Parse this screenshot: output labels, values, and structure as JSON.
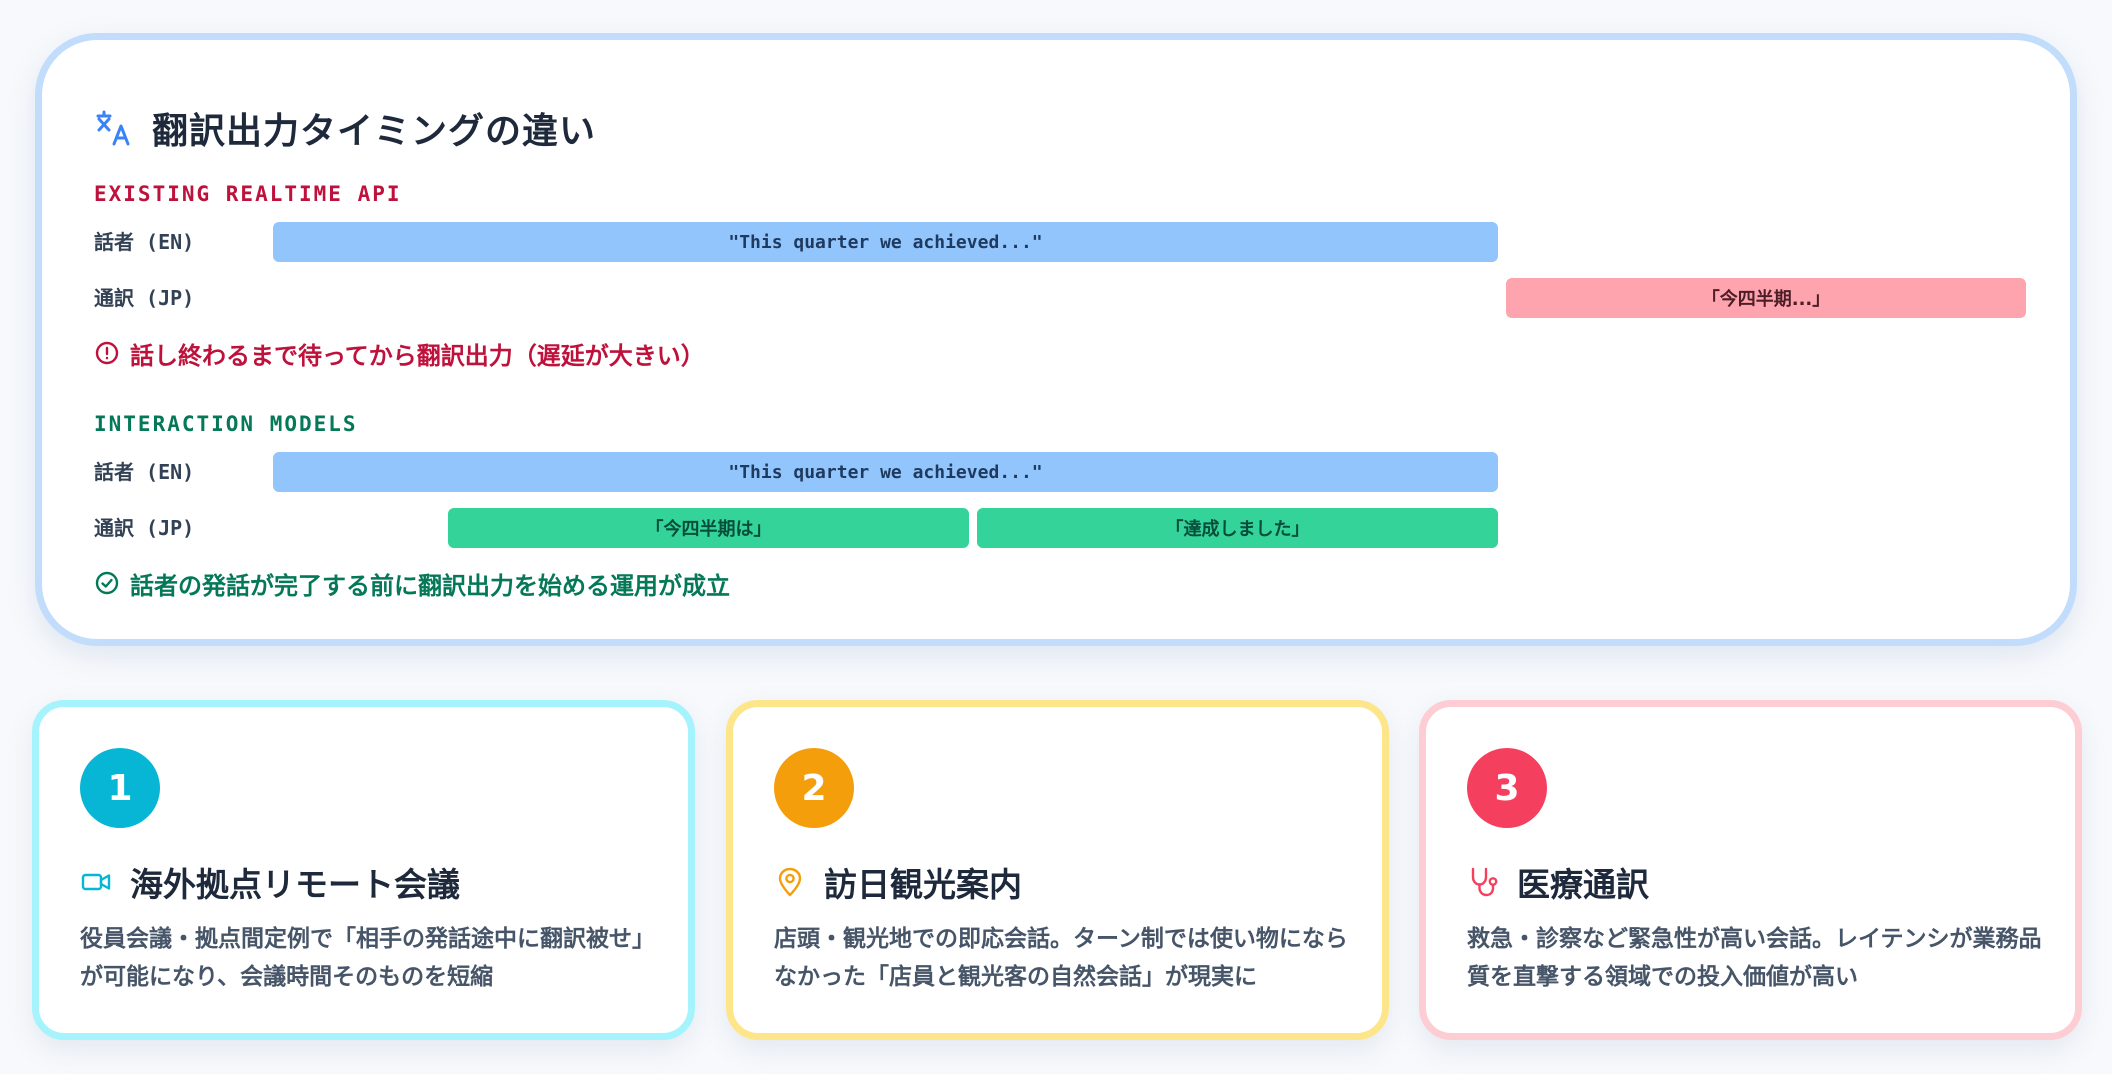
{
  "timing": {
    "title": "翻訳出力タイミングの違い",
    "title_icon": "translate-icon",
    "existing": {
      "label": "EXISTING REALTIME API",
      "speaker_label": "話者 (EN)",
      "speaker_bar": "\"This quarter we achieved...\"",
      "interp_label": "通訳 (JP)",
      "interp_bar": "「今四半期...」",
      "note_icon": "alert-circle-icon",
      "note": "話し終わるまで待ってから翻訳出力（遅延が大きい）"
    },
    "interaction": {
      "label": "INTERACTION MODELS",
      "speaker_label": "話者 (EN)",
      "speaker_bar": "\"This quarter we achieved...\"",
      "interp_label": "通訳 (JP)",
      "interp_bars": [
        "「今四半期は」",
        "「達成しました」"
      ],
      "note_icon": "check-circle-icon",
      "note": "話者の発話が完了する前に翻訳出力を始める運用が成立"
    },
    "colors": {
      "speaker": "#93c5fd",
      "interp_late": "#fda4af",
      "interp_live": "#34d399",
      "warn": "#be123c",
      "ok": "#047857"
    }
  },
  "use_cases": [
    {
      "number": "1",
      "icon": "video-camera-icon",
      "title": "海外拠点リモート会議",
      "description": "役員会議・拠点間定例で「相手の発話途中に翻訳被せ」が可能になり、会議時間そのものを短縮",
      "accent": "#06b6d4"
    },
    {
      "number": "2",
      "icon": "map-pin-icon",
      "title": "訪日観光案内",
      "description": "店頭・観光地での即応会話。ターン制では使い物にならなかった「店員と観光客の自然会話」が現実に",
      "accent": "#f59e0b"
    },
    {
      "number": "3",
      "icon": "stethoscope-icon",
      "title": "医療通訳",
      "description": "救急・診察など緊急性が高い会話。レイテンシが業務品質を直撃する領域での投入価値が高い",
      "accent": "#f43f5e"
    }
  ]
}
